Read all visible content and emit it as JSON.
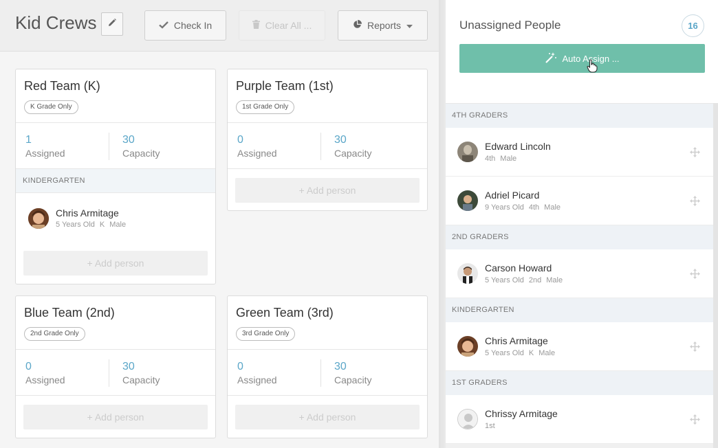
{
  "header": {
    "title": "Kid Crews",
    "check_in": "Check In",
    "clear_all": "Clear All ...",
    "reports": "Reports"
  },
  "teams": [
    {
      "name": "Red Team (K)",
      "grade": "K Grade Only",
      "assigned": "1",
      "assigned_label": "Assigned",
      "capacity": "30",
      "capacity_label": "Capacity",
      "section": "KINDERGARTEN",
      "members": [
        {
          "name": "Chris Armitage",
          "meta": [
            "5 Years Old",
            "K",
            "Male"
          ]
        }
      ],
      "add_label": "+ Add person"
    },
    {
      "name": "Purple Team (1st)",
      "grade": "1st Grade Only",
      "assigned": "0",
      "assigned_label": "Assigned",
      "capacity": "30",
      "capacity_label": "Capacity",
      "add_label": "+ Add person"
    },
    {
      "name": "Blue Team (2nd)",
      "grade": "2nd Grade Only",
      "assigned": "0",
      "assigned_label": "Assigned",
      "capacity": "30",
      "capacity_label": "Capacity",
      "add_label": "+ Add person"
    },
    {
      "name": "Green Team (3rd)",
      "grade": "3rd Grade Only",
      "assigned": "0",
      "assigned_label": "Assigned",
      "capacity": "30",
      "capacity_label": "Capacity",
      "add_label": "+ Add person"
    }
  ],
  "panel": {
    "title": "Unassigned People",
    "count": "16",
    "auto_assign": "Auto Assign ...",
    "sections": [
      {
        "label": "4TH GRADERS",
        "people": [
          {
            "name": "Edward Lincoln",
            "meta": [
              "4th",
              "Male"
            ]
          },
          {
            "name": "Adriel Picard",
            "meta": [
              "9 Years Old",
              "4th",
              "Male"
            ]
          }
        ]
      },
      {
        "label": "2ND GRADERS",
        "people": [
          {
            "name": "Carson Howard",
            "meta": [
              "5 Years Old",
              "2nd",
              "Male"
            ]
          }
        ]
      },
      {
        "label": "KINDERGARTEN",
        "people": [
          {
            "name": "Chris Armitage",
            "meta": [
              "5 Years Old",
              "K",
              "Male"
            ]
          }
        ]
      },
      {
        "label": "1ST GRADERS",
        "people": [
          {
            "name": "Chrissy Armitage",
            "meta": [
              "1st"
            ]
          }
        ]
      }
    ]
  },
  "colors": {
    "accent_blue": "#5aa6c8",
    "auto_assign_green": "#6fbfaa",
    "section_bg": "#eef2f6"
  }
}
